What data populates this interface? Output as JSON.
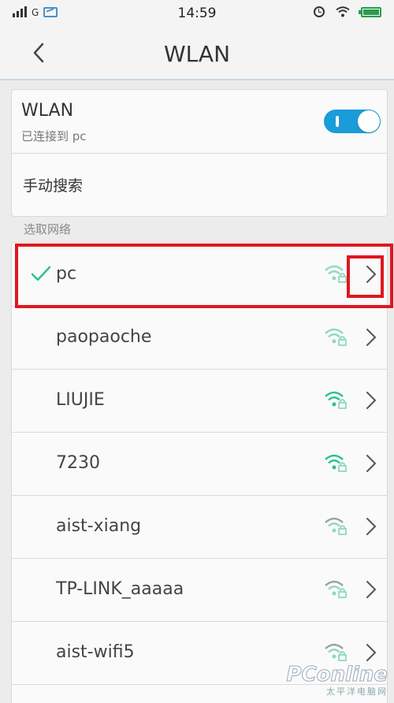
{
  "status_bar": {
    "network_type": "G",
    "time": "14:59"
  },
  "header": {
    "title": "WLAN"
  },
  "wlan_card": {
    "label": "WLAN",
    "status": "已连接到 pc",
    "toggle_on": true,
    "manual_search_label": "手动搜索"
  },
  "networks_section": {
    "label": "选取网络",
    "networks": [
      {
        "ssid": "pc",
        "connected": true,
        "signal": "full"
      },
      {
        "ssid": "paopaoche",
        "connected": false,
        "signal": "full"
      },
      {
        "ssid": "LIUJIE",
        "connected": false,
        "signal": "full"
      },
      {
        "ssid": "7230",
        "connected": false,
        "signal": "full"
      },
      {
        "ssid": "aist-xiang",
        "connected": false,
        "signal": "medium"
      },
      {
        "ssid": "TP-LINK_aaaaa",
        "connected": false,
        "signal": "medium"
      },
      {
        "ssid": "aist-wifi5",
        "connected": false,
        "signal": "medium"
      }
    ]
  },
  "watermark": {
    "brand": "PConline",
    "sub": "太平洋电脑网"
  },
  "colors": {
    "accent": "#1a9cd9",
    "check": "#2cc28a",
    "highlight": "#e0161f",
    "wifi_strong": "#2cc28a",
    "wifi_weak": "#8fd9bf"
  },
  "icons": {
    "back": "chevron-left-icon",
    "check": "check-icon",
    "wifi": "wifi-lock-icon",
    "detail": "chevron-right-icon"
  }
}
